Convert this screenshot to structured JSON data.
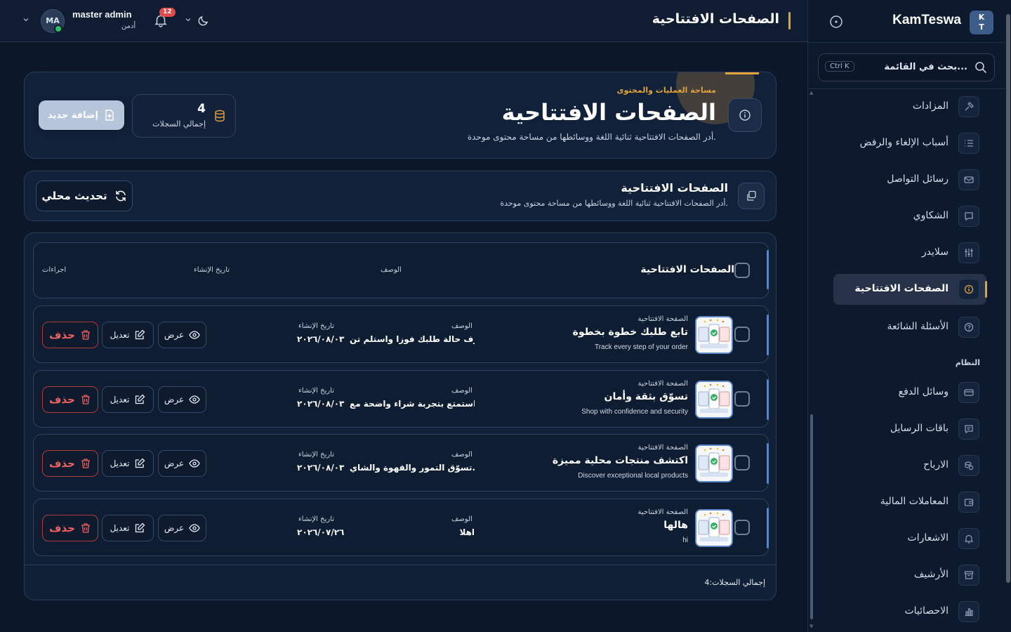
{
  "brand": {
    "name": "KamTeswa",
    "logo_text": "K T"
  },
  "header": {
    "title": "الصفحات الافتتاحية",
    "user_name": "master admin",
    "user_role": "أدمن",
    "avatar_initials": "MA",
    "notifications_count": "12"
  },
  "search": {
    "placeholder": "بحث في القائمة...",
    "shortcut": "Ctrl K"
  },
  "sidebar": {
    "items": [
      {
        "label": "المزادات",
        "icon": "gavel-icon"
      },
      {
        "label": "أسباب الإلغاء والرفض",
        "icon": "list-icon"
      },
      {
        "label": "رسائل التواصل",
        "icon": "mail-icon"
      },
      {
        "label": "الشكاوي",
        "icon": "message-icon"
      },
      {
        "label": "سلايدر",
        "icon": "sliders-icon"
      },
      {
        "label": "الصفحات الافتتاحية",
        "icon": "info-icon",
        "active": true
      },
      {
        "label": "الأسئلة الشائعة",
        "icon": "help-icon"
      }
    ],
    "system_section": "النظام",
    "system_items": [
      {
        "label": "وسائل الدفع",
        "icon": "card-icon"
      },
      {
        "label": "باقات الرسايل",
        "icon": "chat-icon"
      },
      {
        "label": "الارباح",
        "icon": "coins-icon"
      },
      {
        "label": "المعاملات المالية",
        "icon": "wallet-icon"
      },
      {
        "label": "الاشعارات",
        "icon": "bell-icon"
      },
      {
        "label": "الأرشيف",
        "icon": "archive-icon"
      },
      {
        "label": "الاحصائيات",
        "icon": "chart-icon"
      }
    ]
  },
  "hero": {
    "kicker": "مساحة العمليات والمحتوى",
    "title": "الصفحات الافتتاحية",
    "description": "أدر الصفحات الافتتاحية ثنائية اللغة ووسائطها من مساحة محتوى موحدة.",
    "stat_value": "4",
    "stat_label": "إجمالي السجلات",
    "add_button": "إضافة جديد"
  },
  "section": {
    "title": "الصفحات الافتتاحية",
    "description": "أدر الصفحات الافتتاحية ثنائية اللغة ووسائطها من مساحة محتوى موحدة.",
    "refresh_button": "تحديث محلي"
  },
  "table": {
    "headers": {
      "main": "الصفحات الافتتاحية",
      "description": "الوصف",
      "created": "تاريخ الإنشاء",
      "actions": "اجراءات"
    },
    "cell_labels": {
      "kicker": "الصفحة الافتتاحية",
      "description": "الوصف",
      "created": "تاريخ الإنشاء"
    },
    "actions": {
      "view": "عرض",
      "edit": "تعديل",
      "delete": "حذف"
    },
    "rows": [
      {
        "title": "تابع طلبك خطوة بخطوة",
        "subtitle": "Track every step of your order",
        "description": "اعرف حالة طلبك فوزا واستلم تن...",
        "created": "٢٠٢٦/٠٨/٠٣"
      },
      {
        "title": "تسوّق بثقة وأمان",
        "subtitle": "Shop with confidence and security",
        "description": "استمتع بتجربة شراء واضحة مع ...",
        "created": "٢٠٢٦/٠٨/٠٣"
      },
      {
        "title": "اكتشف منتجات محلية مميزة",
        "subtitle": "Discover exceptional local products",
        "description": "تسوّق التمور والقهوة والشاي...",
        "created": "٢٠٢٦/٠٨/٠٣"
      },
      {
        "title": "هالها",
        "subtitle": "hi",
        "description": "اهلا",
        "created": "٢٠٢٦/٠٧/٢٦"
      }
    ],
    "footer": "إجمالي السجلات:4"
  }
}
